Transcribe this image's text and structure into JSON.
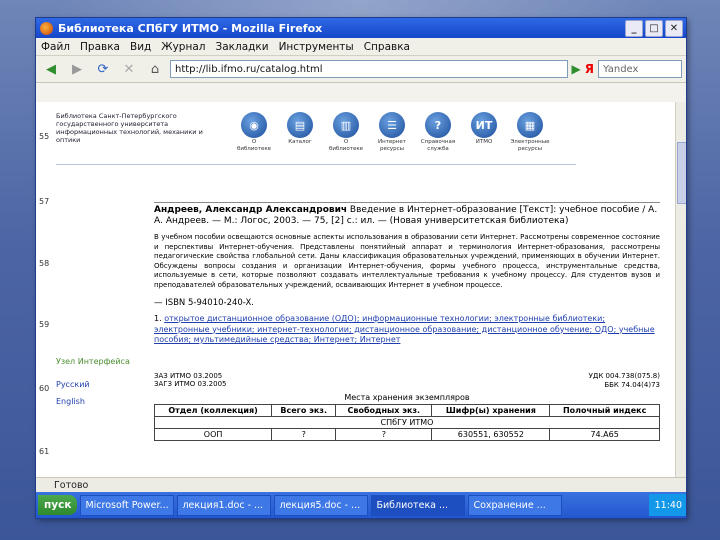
{
  "window": {
    "title": "Библиотека СПбГУ ИТМО - Mozilla Firefox",
    "buttons": [
      "_",
      "□",
      "✕"
    ]
  },
  "menu": [
    "Файл",
    "Правка",
    "Вид",
    "Журнал",
    "Закладки",
    "Инструменты",
    "Справка"
  ],
  "navbar": {
    "url": "http://lib.ifmo.ru/catalog.html",
    "search_value": "Yandex"
  },
  "line_numbers": [
    "55",
    "57",
    "58",
    "59",
    "60",
    "61"
  ],
  "header": {
    "institution": "Библиотека Санкт-Петербургского государственного университета информационных технологий, механики и оптики",
    "nav_items": [
      {
        "icon": "◉",
        "label": "О библиотеке"
      },
      {
        "icon": "▤",
        "label": "Каталог"
      },
      {
        "icon": "▥",
        "label": "О библиотеке"
      },
      {
        "icon": "☰",
        "label": "Интернет ресурсы"
      },
      {
        "icon": "?",
        "label": "Справочная служба"
      },
      {
        "icon": "ИТ",
        "label": "ИТМО"
      },
      {
        "icon": "▦",
        "label": "Электронные ресурсы"
      }
    ]
  },
  "book": {
    "author": "Андреев, Александр Александрович",
    "title_line": " Введение в Интернет-образование [Текст]: учебное пособие / А. А. Андреев. — М.: Логос, 2003. — 75, [2] с.: ил. — (Новая университетская библиотека)",
    "abstract": "В учебном пособии освещаются основные аспекты использования в образовании сети Интернет. Рассмотрены современное состояние и перспективы Интернет-обучения. Представлены понятийный аппарат и терминология Интернет-образования, рассмотрены педагогические свойства глобальной сети. Даны классификация образовательных учреждений, применяющих в обучении Интернет. Обсуждены вопросы создания и организации Интернет-обучения, формы учебного процесса, инструментальные средства, используемые в сети, которые позволяют создавать интеллектуальные требования к учебному процессу. Для студентов вузов и преподавателей образовательных учреждений, осваивающих Интернет в учебном процессе.",
    "isbn": "— ISBN 5-94010-240-X.",
    "subjects_prefix": "1. ",
    "subjects": "открытое дистанционное образование (ОДО); информационные технологии; электронные библиотеки; электронные учебники; интернет-технологии; дистанционное образование; дистанционное обучение; ОДО; учебные пособия; мультимедийные средства; Интернет; Интернет",
    "udk": "УДК 004.738(075.8)",
    "bbk": "ББК 74.04(4)73",
    "meta_left": [
      "ЗАЗ ИТМО 03.2005",
      "ЗАГЗ ИТМО 03.2005"
    ],
    "locations_title": "Места хранения экземпляров",
    "table_headers": [
      "Отдел (коллекция)",
      "Всего экз.",
      "Свободных экз.",
      "Шифр(ы) хранения",
      "Полочный индекс"
    ],
    "table_org": "СПбГУ ИТМО",
    "table_row": [
      "ООП",
      "?",
      "?",
      "630551, 630552",
      "74.А65"
    ]
  },
  "sidebar": {
    "ext_link": "Узел Интерфейса",
    "links": [
      "Русский",
      "English"
    ]
  },
  "statusbar": "Готово",
  "taskbar": {
    "start": "пуск",
    "tasks": [
      "Microsoft Power...",
      "лекция1.doc - ...",
      "лекция5.doc - ...",
      "Библиотека ...",
      "Сохранение ..."
    ],
    "active_index": 3,
    "tray": "11:40"
  }
}
